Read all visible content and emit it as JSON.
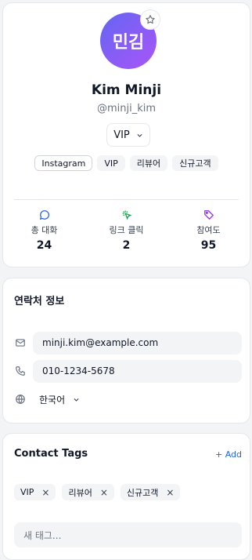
{
  "profile": {
    "avatar_initials": "민김",
    "name": "Kim Minji",
    "handle": "@minji_kim",
    "tier": "VIP",
    "chips": [
      {
        "label": "Instagram"
      },
      {
        "label": "VIP"
      },
      {
        "label": "리뷰어"
      },
      {
        "label": "신규고객"
      }
    ],
    "stats": [
      {
        "icon": "chat-bubble-icon",
        "label": "총 대화",
        "value": "24",
        "color": "#2563eb"
      },
      {
        "icon": "cursor-click-icon",
        "label": "링크 클릭",
        "value": "2",
        "color": "#16a34a"
      },
      {
        "icon": "tag-icon",
        "label": "참여도",
        "value": "95",
        "color": "#9333ea"
      }
    ]
  },
  "contact": {
    "title": "연락처 정보",
    "email": "minji.kim@example.com",
    "phone": "010-1234-5678",
    "language": "한국어"
  },
  "tags": {
    "title": "Contact Tags",
    "add_label": "+ Add",
    "items": [
      {
        "label": "VIP",
        "remove": "×"
      },
      {
        "label": "리뷰어",
        "remove": "×"
      },
      {
        "label": "신규고객",
        "remove": "×"
      }
    ],
    "new_tag_placeholder": "새 태그..."
  }
}
